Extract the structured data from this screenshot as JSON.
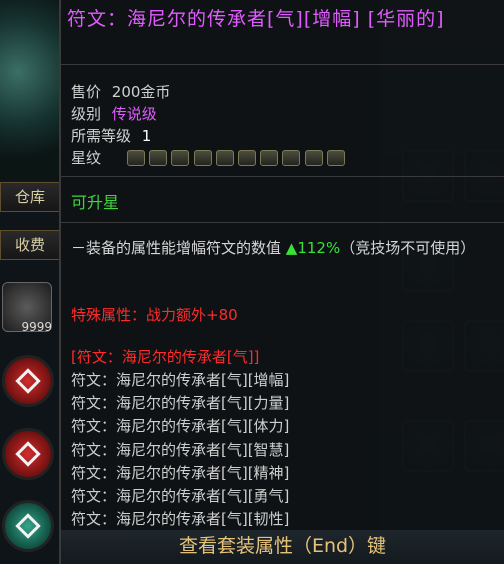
{
  "background": {
    "side_tabs": [
      "仓库",
      "收费"
    ],
    "item_count": "9999"
  },
  "tooltip": {
    "title": "符文：海尼尔的传承者[气][增幅] [华丽的]",
    "price_label": "售价",
    "price_value": "200金币",
    "rank_label": "级别",
    "rank_value": "传说级",
    "level_label": "所需等级",
    "level_value": "1",
    "star_label": "星纹",
    "star_slots_count": 10,
    "upgradeable": "可升星",
    "effect_prefix": "－装备的属性能增幅符文的数值 ",
    "effect_value": "▲112%",
    "effect_suffix": "（竞技场不可使用）",
    "special_attr": "特殊属性：战力额外+80",
    "set_title": "[符文：海尼尔的传承者[气]]",
    "set_items": [
      "符文：海尼尔的传承者[气][增幅]",
      "符文：海尼尔的传承者[气][力量]",
      "符文：海尼尔的传承者[气][体力]",
      "符文：海尼尔的传承者[气][智慧]",
      "符文：海尼尔的传承者[气][精神]",
      "符文：海尼尔的传承者[气][勇气]",
      "符文：海尼尔的传承者[气][韧性]"
    ],
    "footer": "查看套装属性（End）键"
  },
  "colors": {
    "title": "#e15cff",
    "rank": "#e15cff",
    "upgradeable": "#3fd63f",
    "effect_value": "#38e038",
    "special": "#ff2b2b",
    "footer_text": "#e7c37a"
  }
}
